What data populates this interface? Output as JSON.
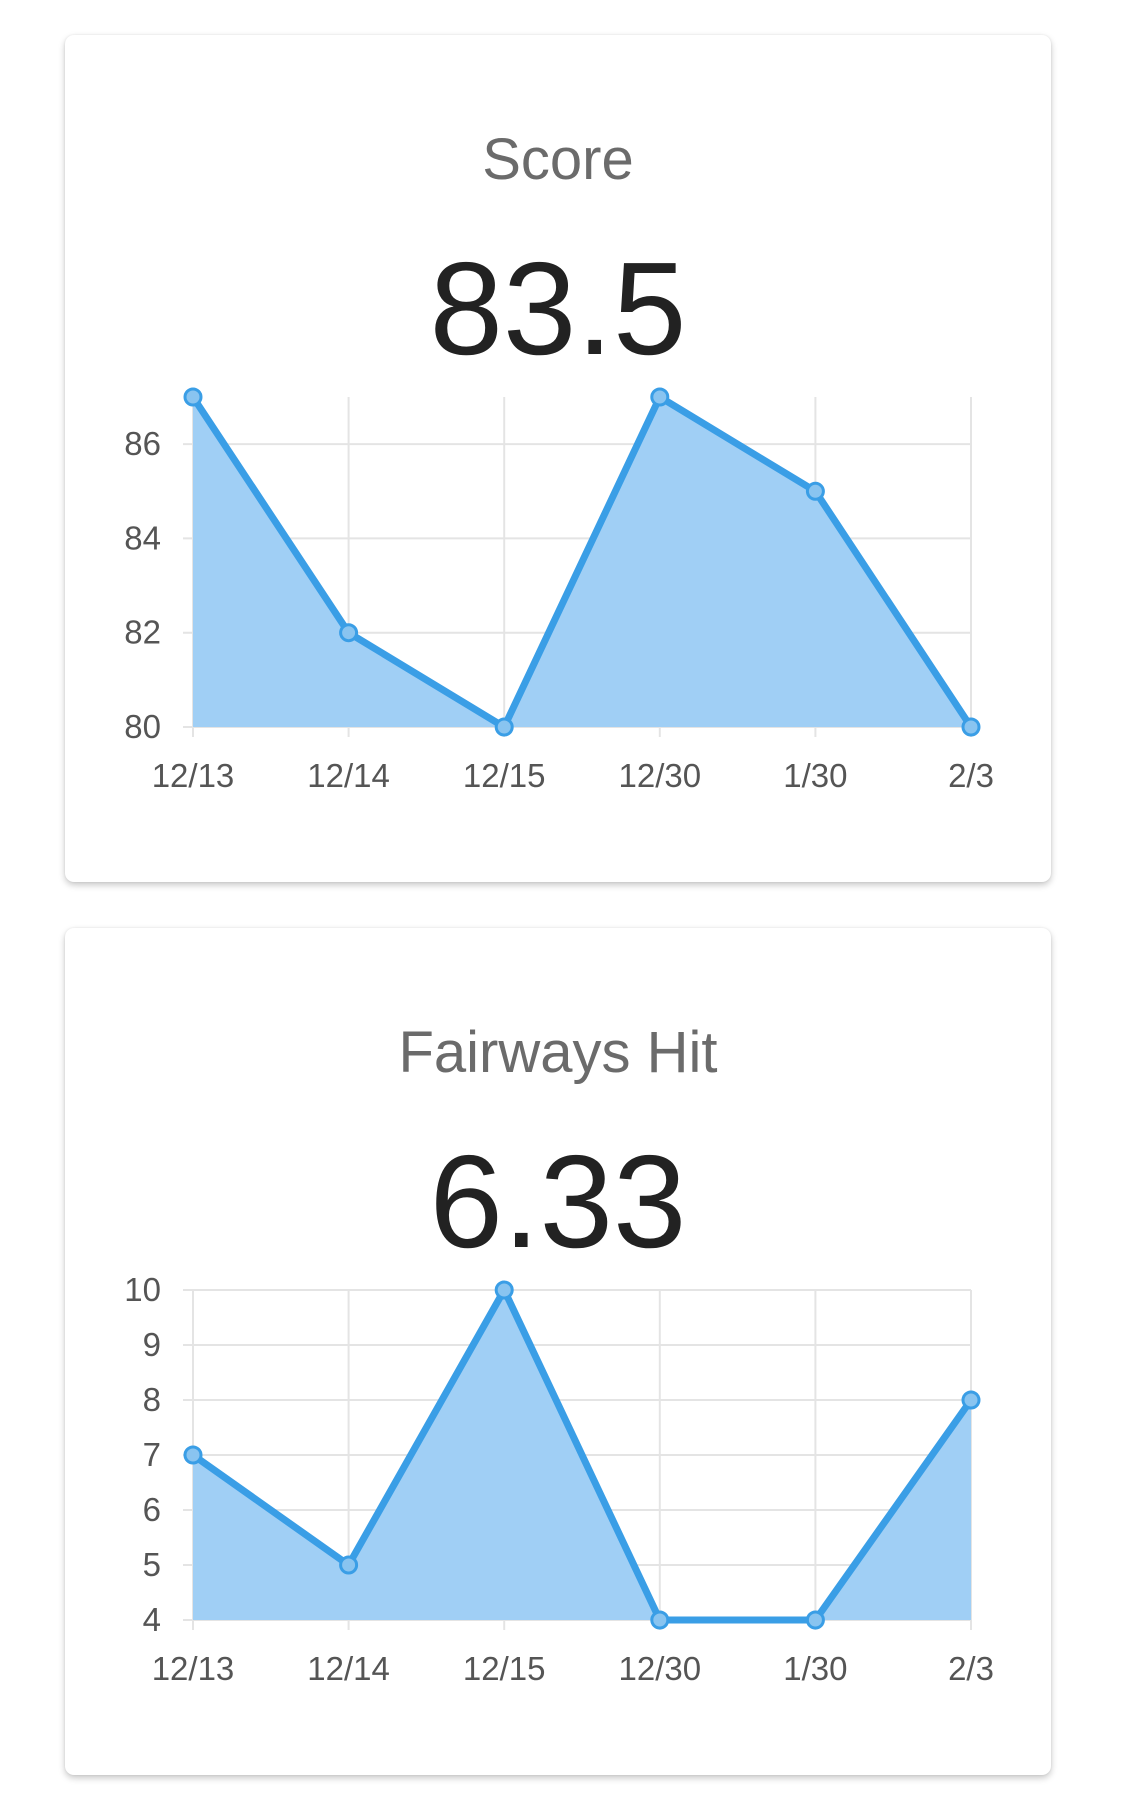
{
  "colors": {
    "line": "#3a9ee6",
    "fill": "#a0cff5",
    "point_fill": "#89c4f0",
    "grid": "#e4e4e4"
  },
  "cards": [
    {
      "title": "Score",
      "value": "83.5"
    },
    {
      "title": "Fairways Hit",
      "value": "6.33"
    }
  ],
  "chart_data": [
    {
      "type": "area",
      "title": "Score",
      "categories": [
        "12/13",
        "12/14",
        "12/15",
        "12/30",
        "1/30",
        "2/3"
      ],
      "series": [
        {
          "values": [
            87,
            82,
            80,
            87,
            85,
            80
          ]
        }
      ],
      "ylim": [
        80,
        87
      ],
      "yticks": [
        80,
        82,
        84,
        86
      ],
      "grid": true,
      "legend": "none"
    },
    {
      "type": "area",
      "title": "Fairways Hit",
      "categories": [
        "12/13",
        "12/14",
        "12/15",
        "12/30",
        "1/30",
        "2/3"
      ],
      "series": [
        {
          "values": [
            7,
            5,
            10,
            4,
            4,
            8
          ]
        }
      ],
      "ylim": [
        4,
        10
      ],
      "yticks": [
        4,
        5,
        6,
        7,
        8,
        9,
        10
      ],
      "grid": true,
      "legend": "none"
    }
  ]
}
